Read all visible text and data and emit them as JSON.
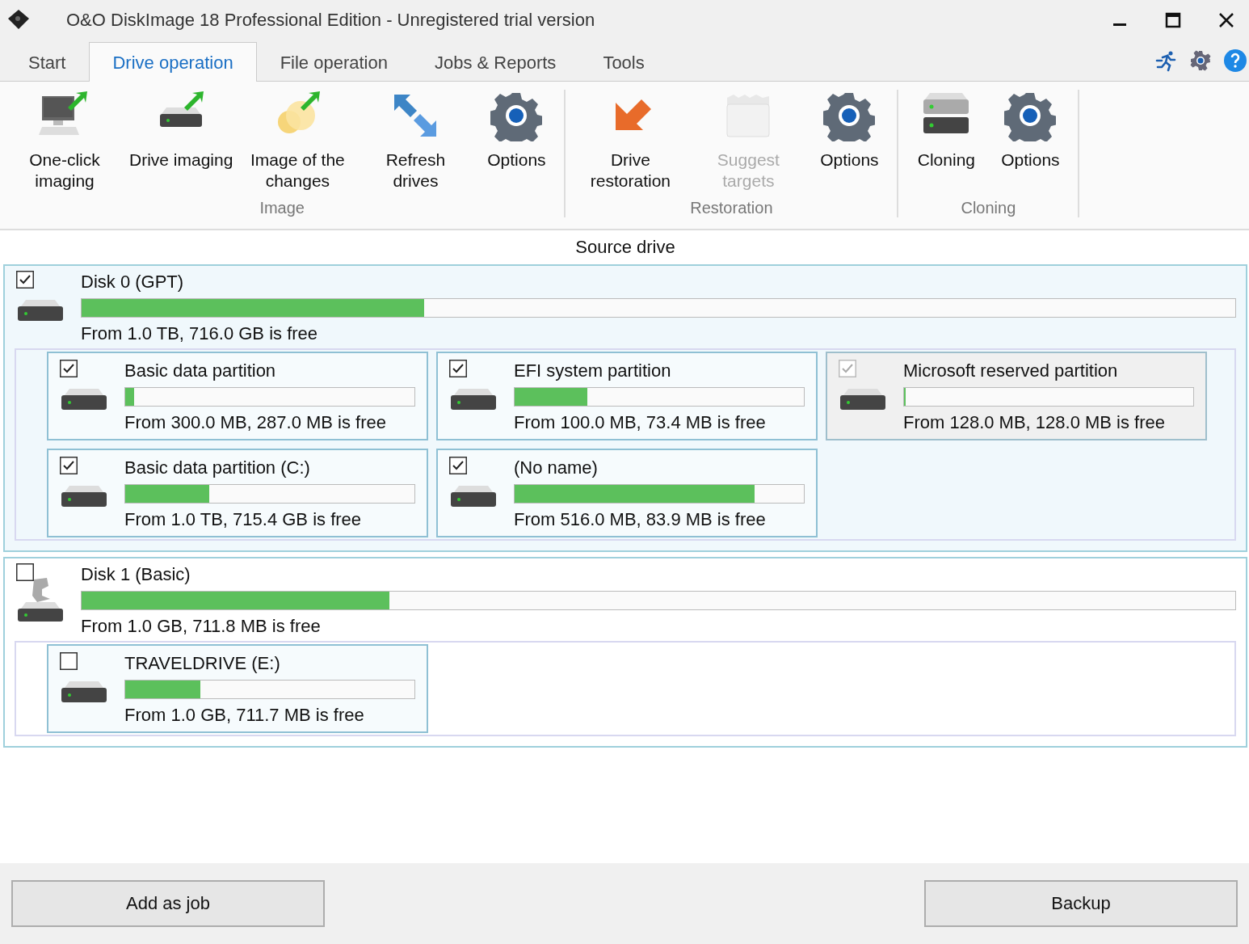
{
  "window": {
    "title": "O&O DiskImage 18 Professional Edition - Unregistered trial version"
  },
  "tabs": [
    {
      "label": "Start",
      "selected": false
    },
    {
      "label": "Drive operation",
      "selected": true
    },
    {
      "label": "File operation",
      "selected": false
    },
    {
      "label": "Jobs & Reports",
      "selected": false
    },
    {
      "label": "Tools",
      "selected": false
    }
  ],
  "ribbon": [
    {
      "label": "Image",
      "buttons": [
        {
          "kind": "monitor",
          "label": "One-click imaging",
          "disabled": false
        },
        {
          "kind": "drive",
          "label": "Drive imaging",
          "disabled": false
        },
        {
          "kind": "changes",
          "label": "Image of the changes",
          "disabled": false
        },
        {
          "kind": "refresh",
          "label": "Refresh drives",
          "disabled": false
        },
        {
          "kind": "gear",
          "label": "Options",
          "disabled": false
        }
      ]
    },
    {
      "label": "Restoration",
      "buttons": [
        {
          "kind": "restore",
          "label": "Drive restoration",
          "disabled": false
        },
        {
          "kind": "folder",
          "label": "Suggest targets",
          "disabled": true
        },
        {
          "kind": "gear",
          "label": "Options",
          "disabled": false
        }
      ]
    },
    {
      "label": "Cloning",
      "buttons": [
        {
          "kind": "clone",
          "label": "Cloning",
          "disabled": false
        },
        {
          "kind": "gear",
          "label": "Options",
          "disabled": false
        }
      ]
    }
  ],
  "source_heading": "Source drive",
  "disks": [
    {
      "kind": "internal",
      "name": "Disk 0 (GPT)",
      "checked": true,
      "selected": true,
      "level": 0.297,
      "summary": "From 1.0 TB, 716.0 GB is free",
      "partitions": [
        {
          "name": "Basic data partition",
          "checked": true,
          "disabled": false,
          "level": 0.03,
          "summary": "From 300.0 MB, 287.0 MB is free"
        },
        {
          "name": "EFI system partition",
          "checked": true,
          "disabled": false,
          "level": 0.25,
          "summary": "From 100.0 MB, 73.4 MB is free"
        },
        {
          "name": "Microsoft reserved partition",
          "checked": true,
          "disabled": true,
          "level": 0.006,
          "summary": "From 128.0 MB, 128.0 MB is free"
        },
        {
          "name": "Basic data partition (C:)",
          "checked": true,
          "disabled": false,
          "level": 0.29,
          "summary": "From 1.0 TB, 715.4 GB is free"
        },
        {
          "name": "(No name)",
          "checked": true,
          "disabled": false,
          "level": 0.83,
          "summary": "From 516.0 MB, 83.9 MB is free"
        }
      ]
    },
    {
      "kind": "usb",
      "name": "Disk 1 (Basic)",
      "checked": false,
      "selected": false,
      "level": 0.267,
      "summary": "From 1.0 GB, 711.8 MB is free",
      "partitions": [
        {
          "name": "TRAVELDRIVE (E:)",
          "checked": false,
          "disabled": false,
          "level": 0.26,
          "summary": "From 1.0 GB, 711.7 MB is free"
        }
      ]
    }
  ],
  "buttons": [
    "Add as job",
    "Backup"
  ]
}
